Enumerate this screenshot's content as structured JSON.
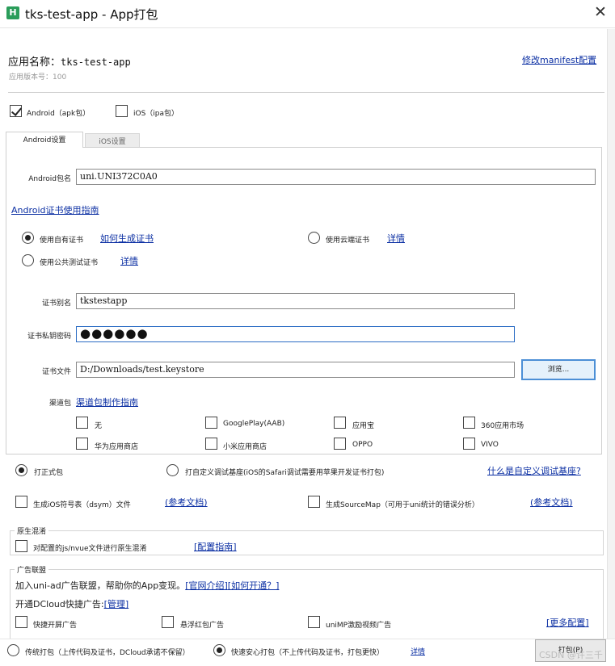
{
  "window": {
    "title": "tks-test-app - App打包",
    "logo_text": "H"
  },
  "app": {
    "name_label": "应用名称：",
    "name": "tks-test-app",
    "version": "应用版本号：100",
    "manifest_link": "修改manifest配置"
  },
  "platforms": {
    "android": "Android（apk包）",
    "ios": "iOS（ipa包）"
  },
  "tabs": [
    "Android设置",
    "iOS设置"
  ],
  "android": {
    "pkg_label": "Android包名",
    "pkg_value": "uni.UNI372C0A0",
    "guide_link": "Android证书使用指南",
    "own_cert": "使用自有证书",
    "how_link": "如何生成证书",
    "cloud_cert": "使用云端证书",
    "cloud_detail": "详情",
    "public_cert": "使用公共测试证书",
    "public_detail": "详情",
    "alias_label": "证书别名",
    "alias_value": "tkstestapp",
    "pwd_label": "证书私钥密码",
    "pwd_value": "●●●●●●",
    "file_label": "证书文件",
    "file_value": "D:/Downloads/test.keystore",
    "browse": "浏览...",
    "channel_label": "渠道包",
    "channel_link": "渠道包制作指南",
    "channels": [
      "无",
      "GooglePlay(AAB)",
      "应用宝",
      "360应用市场",
      "华为应用商店",
      "小米应用商店",
      "OPPO",
      "VIVO"
    ]
  },
  "build": {
    "formal": "打正式包",
    "custom": "打自定义调试基座(iOS的Safari调试需要用苹果开发证书打包)",
    "custom_link": "什么是自定义调试基座?",
    "dsym": "生成iOS符号表（dsym）文件",
    "dsym_link": "(参考文档)",
    "sourcemap": "生成SourceMap（可用于uni统计的错误分析）",
    "sourcemap_link": "(参考文档)"
  },
  "obfuscate": {
    "title": "原生混淆",
    "check": "对配置的js/nvue文件进行原生混淆",
    "link": "[配置指南]"
  },
  "ads": {
    "title": "广告联盟",
    "line1": "加入uni-ad广告联盟，帮助你的App变现。",
    "line1_link1": "[官网介绍]",
    "line1_link2": "[如何开通？]",
    "line2": "开通DCloud快捷广告:",
    "line2_link": "[管理]",
    "opt1": "快捷开屏广告",
    "opt2": "悬浮红包广告",
    "opt3": "uniMP激励视频广告",
    "more": "[更多配置]"
  },
  "bottom": {
    "traditional": "传统打包（上传代码及证书，DCloud承诺不保留）",
    "fast": "快速安心打包（不上传代码及证书，打包更快）",
    "detail": "详情",
    "pack": "打包(P)",
    "watermark": "CSDN @许三千"
  }
}
